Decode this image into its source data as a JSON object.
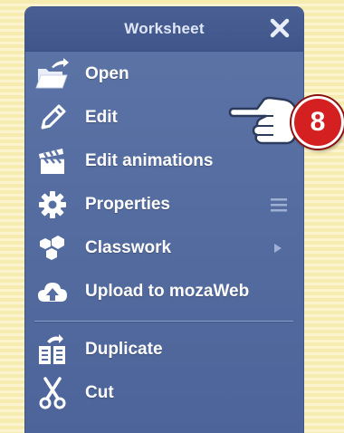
{
  "panel": {
    "title": "Worksheet",
    "close_icon": "close-icon"
  },
  "menu": {
    "items": [
      {
        "label": "Open",
        "icon": "folder-open-icon"
      },
      {
        "label": "Edit",
        "icon": "pencil-icon"
      },
      {
        "label": "Edit animations",
        "icon": "clapperboard-icon"
      },
      {
        "label": "Properties",
        "icon": "gear-icon",
        "trailing_icon": "hamburger-menu-icon"
      },
      {
        "label": "Classwork",
        "icon": "hexagons-icon",
        "trailing_icon": "submenu-arrow-icon"
      },
      {
        "label": "Upload to mozaWeb",
        "icon": "cloud-upload-icon"
      },
      {
        "label": "Duplicate",
        "icon": "duplicate-icon"
      },
      {
        "label": "Cut",
        "icon": "scissors-icon"
      }
    ]
  },
  "callout": {
    "number": "8",
    "badge_color": "#d42020",
    "icon": "pointing-hand-icon"
  },
  "colors": {
    "panel": "#566ea2",
    "header": "#44598e",
    "title_text": "#dfe7f7",
    "item_text": "#ffffff",
    "background": "#f7ecb0"
  }
}
